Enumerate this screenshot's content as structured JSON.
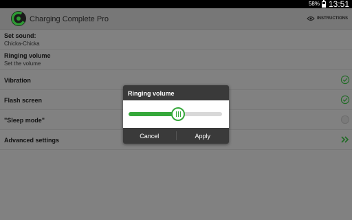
{
  "status_bar": {
    "battery_percent": "58%",
    "battery_icon": "battery-icon",
    "time": "13:51"
  },
  "app_bar": {
    "title": "Charging Complete Pro",
    "logo_icon": "app-logo-icon",
    "instructions_label": "INSTRUCTIONS",
    "instructions_icon": "eye-icon"
  },
  "settings": {
    "set_sound": {
      "label": "Set sound:",
      "value": "Chicka-Chicka"
    },
    "ringing_volume": {
      "label": "Ringing volume",
      "summary": "Set the volume"
    },
    "vibration": {
      "label": "Vibration",
      "checked": true
    },
    "flash_screen": {
      "label": "Flash screen",
      "checked": true
    },
    "sleep_mode": {
      "label": "\"Sleep mode\"",
      "checked": false
    },
    "advanced_settings": {
      "label": "Advanced settings",
      "icon": "double-chevron-right-icon"
    }
  },
  "dialog": {
    "title": "Ringing volume",
    "volume_fraction": 0.53,
    "cancel_label": "Cancel",
    "apply_label": "Apply"
  },
  "colors": {
    "accent_green": "#35a83a",
    "dim_check": "#1f6b24"
  }
}
